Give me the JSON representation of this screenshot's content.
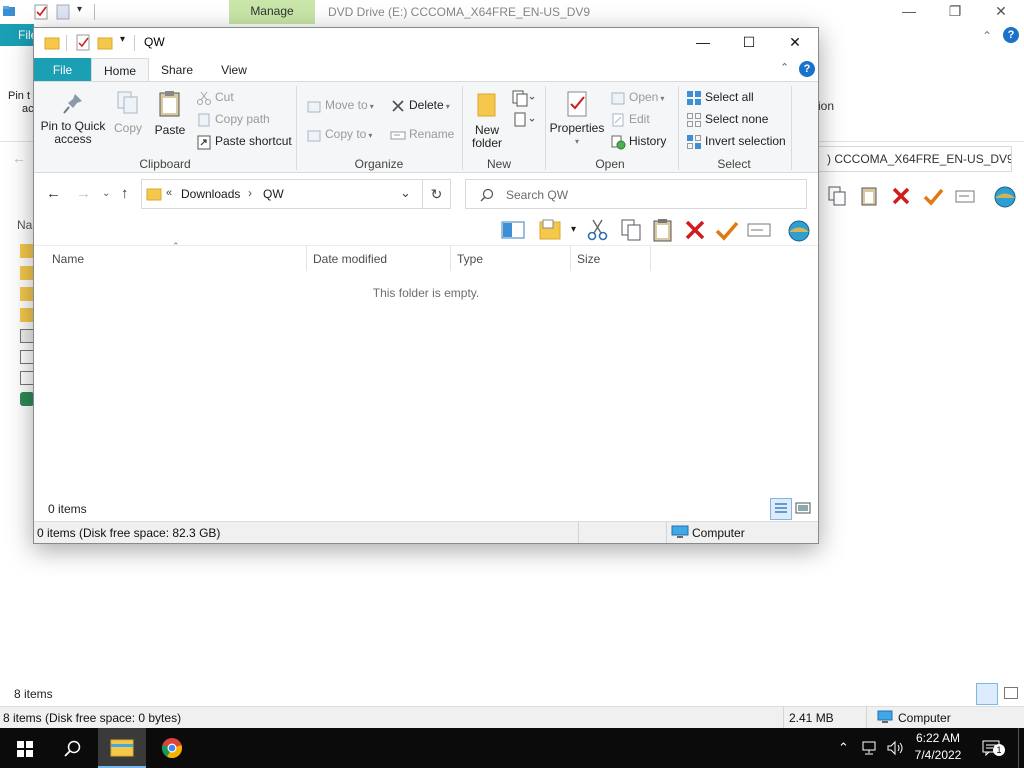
{
  "background_window": {
    "manage_tab": "Manage",
    "title": "DVD Drive (E:) CCCOMA_X64FRE_EN-US_DV9",
    "file_tab": "File",
    "pin_label_line1": "Pin t",
    "pin_label_line2": "ac",
    "ion_label": "ion",
    "address": ") CCCOMA_X64FRE_EN-US_DV9",
    "name_header": "Na",
    "item_count": "8 items",
    "status_left": "8 items (Disk free space: 0 bytes)",
    "status_size": "2.41 MB",
    "status_computer": "Computer"
  },
  "window": {
    "title": "QW",
    "tabs": {
      "file": "File",
      "home": "Home",
      "share": "Share",
      "view": "View"
    },
    "clipboard": {
      "pin_line1": "Pin to Quick",
      "pin_line2": "access",
      "copy": "Copy",
      "paste": "Paste",
      "cut": "Cut",
      "copy_path": "Copy path",
      "paste_shortcut": "Paste shortcut",
      "group": "Clipboard"
    },
    "organize": {
      "move_to": "Move to",
      "copy_to": "Copy to",
      "delete": "Delete",
      "rename": "Rename",
      "group": "Organize"
    },
    "new": {
      "line1": "New",
      "line2": "folder",
      "group": "New"
    },
    "open": {
      "properties": "Properties",
      "open": "Open",
      "edit": "Edit",
      "history": "History",
      "group": "Open"
    },
    "select": {
      "select_all": "Select all",
      "select_none": "Select none",
      "invert": "Invert selection",
      "group": "Select"
    },
    "address": {
      "chevrons": "«",
      "crumb1": "Downloads",
      "separator": "›",
      "crumb2": "QW"
    },
    "search_placeholder": "Search QW",
    "columns": [
      "Name",
      "Date modified",
      "Type",
      "Size"
    ],
    "empty_message": "This folder is empty.",
    "item_count": "0 items",
    "status_left": "0 items (Disk free space: 82.3 GB)",
    "status_computer": "Computer"
  },
  "taskbar": {
    "time": "6:22 AM",
    "date": "7/4/2022",
    "notification_count": "1"
  },
  "colors": {
    "accent_teal": "#1a9fb5",
    "manage_green": "#c8e6a8",
    "delete_red": "#d01c1c",
    "check_orange": "#e07a10",
    "folder_yellow": "#f5c84c",
    "taskbar": "#0b0b0b"
  }
}
